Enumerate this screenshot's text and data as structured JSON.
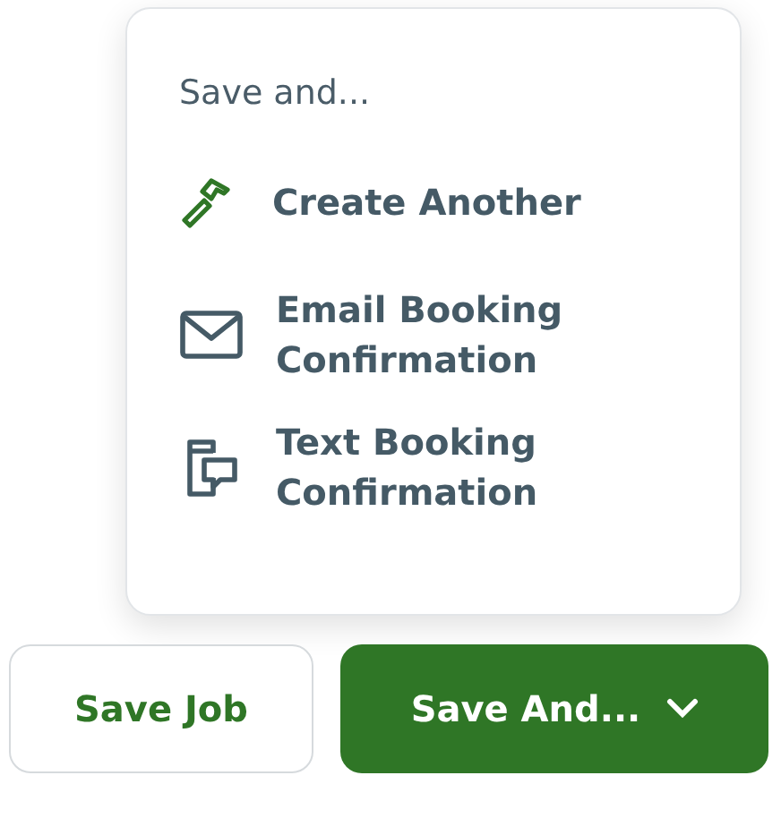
{
  "menu": {
    "heading": "Save and...",
    "items": [
      {
        "kind": "hammer",
        "label": "Create Another"
      },
      {
        "kind": "mail",
        "label": "Email Booking Confirmation"
      },
      {
        "kind": "phone-message",
        "label": "Text Booking Confirmation"
      }
    ]
  },
  "buttons": [
    {
      "kind": "outline",
      "label": "Save Job"
    },
    {
      "kind": "primary",
      "label": "Save And...",
      "caret": true
    }
  ]
}
